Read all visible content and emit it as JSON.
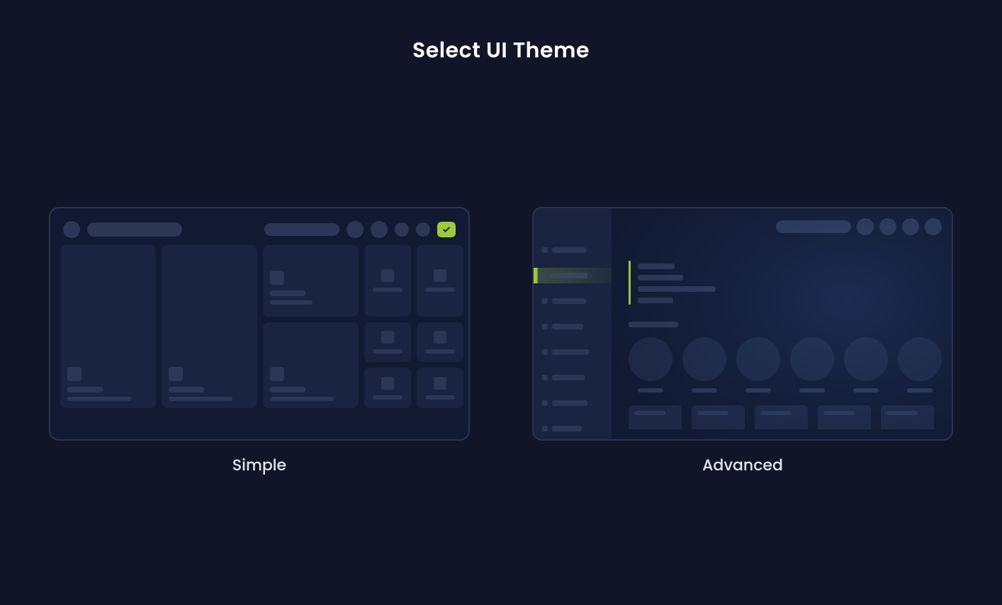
{
  "page": {
    "title": "Select UI Theme"
  },
  "themes": {
    "simple": {
      "label": "Simple"
    },
    "advanced": {
      "label": "Advanced"
    }
  },
  "colors": {
    "background": "#101628",
    "panel": "#121a33",
    "border": "#2a3451",
    "skeleton": "#2d3755",
    "card": "#1a2340",
    "accent": "#9cca3c"
  }
}
